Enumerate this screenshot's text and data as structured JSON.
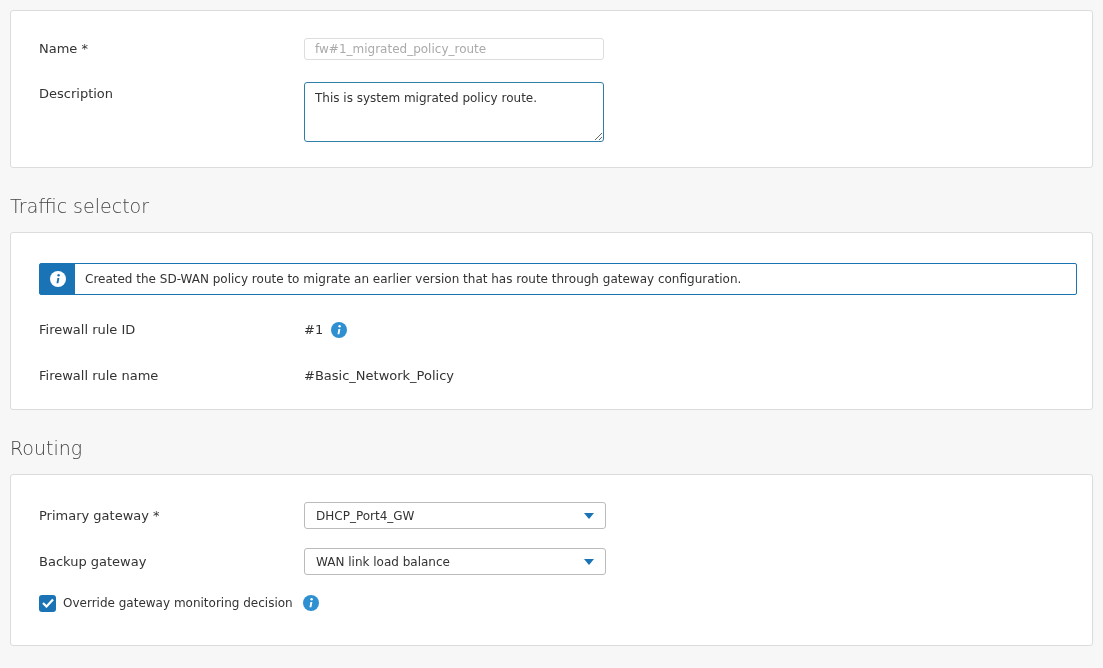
{
  "general": {
    "name": {
      "label": "Name *",
      "value": "fw#1_migrated_policy_route",
      "disabled": true
    },
    "description": {
      "label": "Description",
      "value": "This is system migrated policy route."
    }
  },
  "traffic_selector": {
    "title": "Traffic selector",
    "info_banner": "Created the SD-WAN policy route to migrate an earlier version that has route through gateway configuration.",
    "rows": [
      {
        "label": "Firewall rule ID",
        "value": "#1",
        "info": true
      },
      {
        "label": "Firewall rule name",
        "value": "#Basic_Network_Policy",
        "info": false
      }
    ]
  },
  "routing": {
    "title": "Routing",
    "selects": [
      {
        "label": "Primary gateway *",
        "value": "DHCP_Port4_GW"
      },
      {
        "label": "Backup gateway",
        "value": "WAN link load balance"
      }
    ],
    "checkbox": {
      "label": "Override gateway monitoring decision",
      "checked": true,
      "info": true
    }
  }
}
